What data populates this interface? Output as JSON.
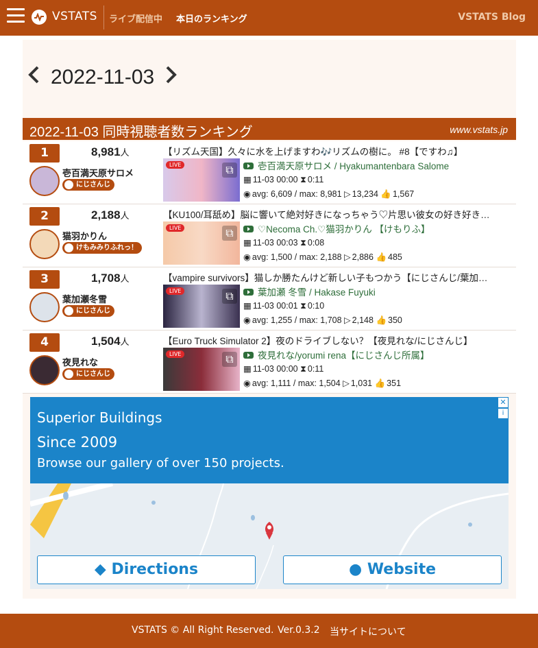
{
  "nav": {
    "brand": "VSTATS",
    "live": "ライブ配信中",
    "ranking": "本日のランキング",
    "blog": "VSTATS Blog"
  },
  "date_nav": {
    "date": "2022-11-03"
  },
  "ranking": {
    "title": "2022-11-03 同時視聴者数ランキング",
    "site": "www.vstats.jp",
    "unit": "人",
    "rows": [
      {
        "rank": "1",
        "viewers": "8,981",
        "name": "壱百満天原サロメ",
        "group": "にじさんじ",
        "title": "【リズム天国】久々に水を上げますわ🎶リズムの樹に。 #8【ですわ♫】",
        "channel": "壱百満天原サロメ / Hyakumantenbara Salome",
        "start": "11-03 00:00",
        "duration": "0:11",
        "avg": "avg: 6,609 / max: 8,981",
        "views": "13,234",
        "likes": "1,567"
      },
      {
        "rank": "2",
        "viewers": "2,188",
        "name": "猫羽かりん",
        "group": "けもみみりふれっ！",
        "title": "【KU100/耳舐め】脳に響いて絶対好きになっちゃう♡片思い彼女の好き好き…",
        "channel": "♡Necoma Ch.♡猫羽かりん 【けもりふ】",
        "start": "11-03 00:03",
        "duration": "0:08",
        "avg": "avg: 1,500 / max: 2,188",
        "views": "2,886",
        "likes": "485"
      },
      {
        "rank": "3",
        "viewers": "1,708",
        "name": "葉加瀬冬雪",
        "group": "にじさんじ",
        "title": "【vampire survivors】猫しか勝たんけど新しい子もつかう【にじさんじ/葉加…",
        "channel": "葉加瀬 冬雪 / Hakase Fuyuki",
        "start": "11-03 00:01",
        "duration": "0:10",
        "avg": "avg: 1,255 / max: 1,708",
        "views": "2,148",
        "likes": "350"
      },
      {
        "rank": "4",
        "viewers": "1,504",
        "name": "夜見れな",
        "group": "にじさんじ",
        "title": "【Euro Truck Simulator 2】夜のドライブしない？【夜見れな/にじさんじ】",
        "channel": "夜見れな/yorumi rena【にじさんじ所属】",
        "start": "11-03 00:00",
        "duration": "0:11",
        "avg": "avg: 1,111 / max: 1,504",
        "views": "1,031",
        "likes": "351"
      }
    ]
  },
  "ad": {
    "line1": "Superior Buildings",
    "line2": "Since 2009",
    "line3": "Browse our gallery of over 150 projects.",
    "directions": "Directions",
    "website": "Website",
    "close": "✕",
    "info": "i"
  },
  "footer": {
    "copyright": "VSTATS © All Right Reserved.",
    "version": "Ver.0.3.2",
    "about": "当サイトについて"
  },
  "colors": {
    "brand": "#b44c10",
    "channel": "#2e6e3a",
    "ad": "#1b84c9",
    "live": "#e0282a"
  }
}
